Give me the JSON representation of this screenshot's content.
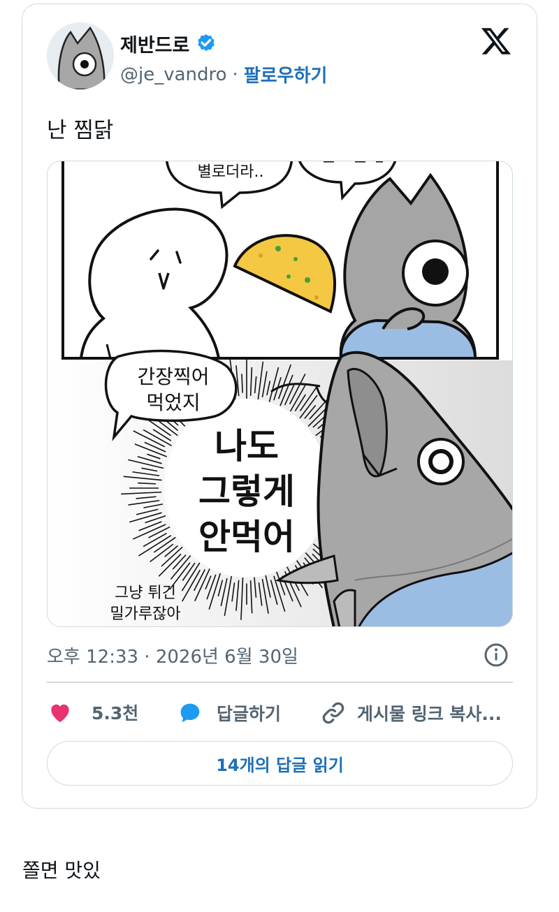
{
  "tweet": {
    "display_name": "제반드로",
    "handle": "@je_vandro",
    "separator": "·",
    "follow_label": "팔로우하기",
    "text": "난 찜닭",
    "timestamp": "오후 12:33 · 2026년 6월 30일"
  },
  "comic": {
    "bubble_top_left": "별로더라..",
    "bubble_left_1": "간장찍어",
    "bubble_left_2": "먹었지",
    "shout_1": "나도",
    "shout_2": "그렇게",
    "shout_3": "안먹어",
    "caption_1": "그냥 튀긴",
    "caption_2": "밀가루잖아"
  },
  "actions": {
    "likes": "5.3천",
    "reply_label": "답글하기",
    "copy_link_label": "게시물 링크 복사..."
  },
  "read_replies_label": "14개의 답글 읽기",
  "comment": "쫄면 맛있",
  "colors": {
    "like_red": "#e8336f",
    "reply_blue": "#1d9bf0",
    "link_blue": "#1d6fb8",
    "verified_blue": "#1d9bf0",
    "fish_gray": "#a5a5a5",
    "shirt_blue": "#9cbde3",
    "egg_yellow": "#f4c842"
  },
  "icons": [
    "avatar-fish",
    "verified-badge-icon",
    "x-logo-icon",
    "info-icon",
    "heart-icon",
    "speech-bubble-icon",
    "link-icon"
  ]
}
